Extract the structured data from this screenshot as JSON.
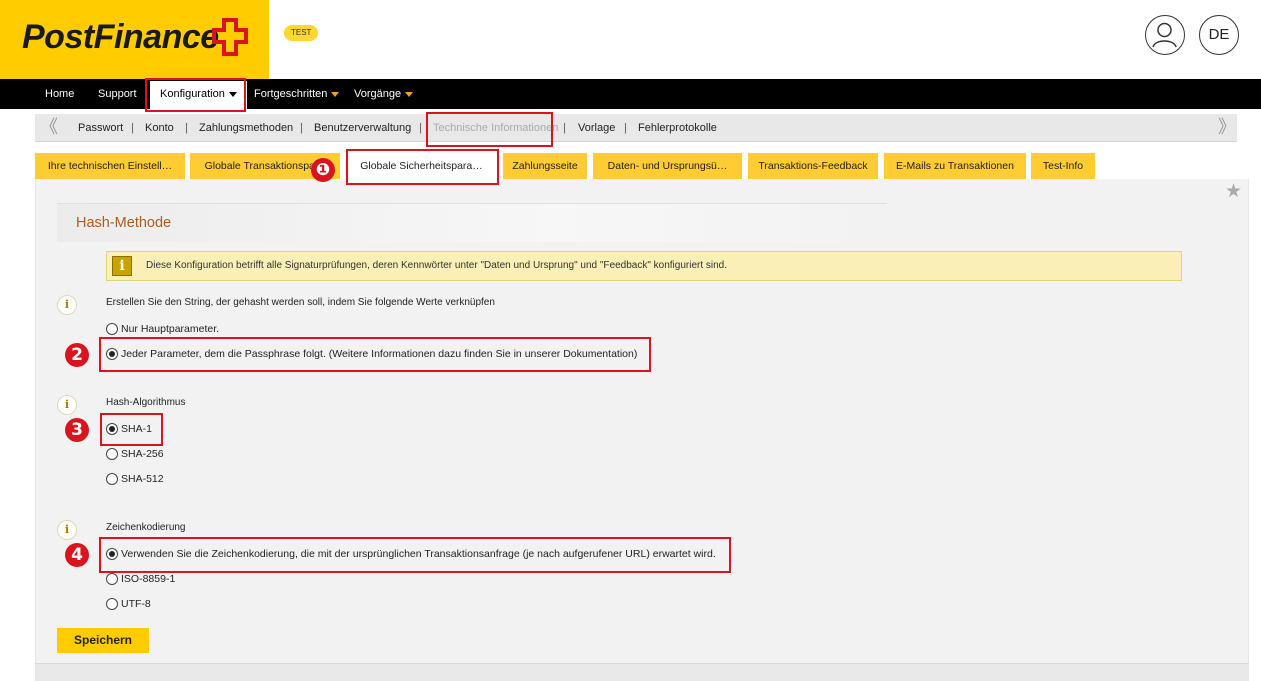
{
  "header": {
    "logo_text": "PostFinance",
    "badge": "TEST",
    "language": "DE",
    "brand_color": "#ffcc00"
  },
  "mainnav": {
    "items": [
      {
        "label": "Home"
      },
      {
        "label": "Support"
      },
      {
        "label": "Konfiguration",
        "active": true
      },
      {
        "label": "Fortgeschritten"
      },
      {
        "label": "Vorgänge"
      }
    ]
  },
  "subnav": {
    "items": [
      {
        "label": "Passwort"
      },
      {
        "label": "Konto"
      },
      {
        "label": "Zahlungsmethoden"
      },
      {
        "label": "Benutzerverwaltung"
      },
      {
        "label": "Technische Informationen",
        "active": true
      },
      {
        "label": "Vorlage"
      },
      {
        "label": "Fehlerprotokolle"
      }
    ],
    "separator": "|",
    "prev_arrow": "《",
    "next_arrow": "》"
  },
  "tabs": [
    {
      "label": "Ihre technischen Einstell…"
    },
    {
      "label": "Globale Transaktionspa…"
    },
    {
      "label": "Globale Sicherheitspara…",
      "active": true
    },
    {
      "label": "Zahlungsseite"
    },
    {
      "label": "Daten- und Ursprungsü…"
    },
    {
      "label": "Transaktions-Feedback"
    },
    {
      "label": "E-Mails zu Transaktionen"
    },
    {
      "label": "Test-Info"
    }
  ],
  "section": {
    "title": "Hash-Methode",
    "notice": "Diese Konfiguration betrifft alle Signaturprüfungen, deren Kennwörter unter \"Daten und Ursprung\" und \"Feedback\" konfiguriert sind.",
    "notice_icon": "i"
  },
  "fields": {
    "string": {
      "label": "Erstellen Sie den String, der gehasht werden soll, indem Sie folgende Werte verknüpfen",
      "options": [
        "Nur Hauptparameter.",
        "Jeder Parameter, dem die Passphrase folgt. (Weitere Informationen dazu finden Sie in unserer Dokumentation)"
      ],
      "selected": 1
    },
    "algorithm": {
      "label": "Hash-Algorithmus",
      "options": [
        "SHA-1",
        "SHA-256",
        "SHA-512"
      ],
      "selected": 0
    },
    "encoding": {
      "label": "Zeichenkodierung",
      "options": [
        "Verwenden Sie die Zeichenkodierung, die mit der ursprünglichen Transaktionsanfrage (je nach aufgerufener URL) erwartet wird.",
        "ISO-8859-1",
        "UTF-8"
      ],
      "selected": 0
    }
  },
  "info_icon": "i",
  "save_label": "Speichern",
  "annotations": {
    "markers": [
      "❶",
      "2",
      "3",
      "4"
    ],
    "color": "#d9141e"
  }
}
